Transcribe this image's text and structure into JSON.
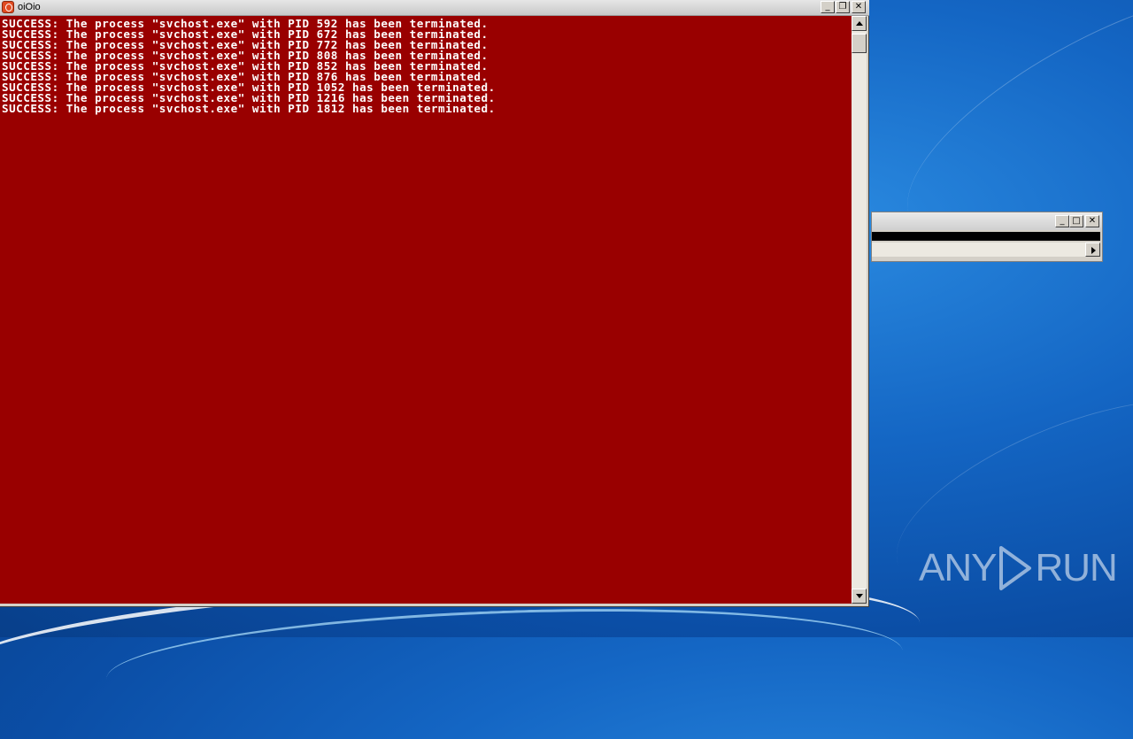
{
  "console_window": {
    "title": "oiOio",
    "controls": {
      "minimize": "_",
      "maximize": "❐",
      "close": "✕"
    },
    "lines": [
      "SUCCESS: The process \"svchost.exe\" with PID 592 has been terminated.",
      "SUCCESS: The process \"svchost.exe\" with PID 672 has been terminated.",
      "SUCCESS: The process \"svchost.exe\" with PID 772 has been terminated.",
      "SUCCESS: The process \"svchost.exe\" with PID 808 has been terminated.",
      "SUCCESS: The process \"svchost.exe\" with PID 852 has been terminated.",
      "SUCCESS: The process \"svchost.exe\" with PID 876 has been terminated.",
      "SUCCESS: The process \"svchost.exe\" with PID 1052 has been terminated.",
      "SUCCESS: The process \"svchost.exe\" with PID 1216 has been terminated.",
      "SUCCESS: The process \"svchost.exe\" with PID 1812 has been terminated."
    ],
    "background_color": "#990000",
    "text_color": "#ffffff"
  },
  "small_window": {
    "controls": {
      "minimize": "_",
      "maximize": "□",
      "close": "✕"
    }
  },
  "watermark": {
    "left_text": "ANY",
    "right_text": "RUN"
  }
}
